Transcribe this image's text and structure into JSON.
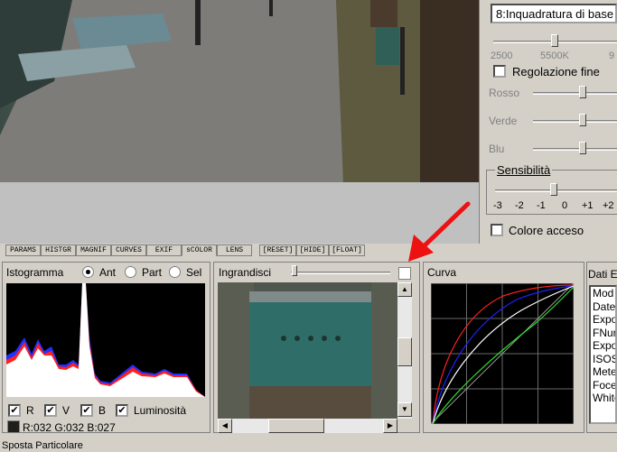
{
  "right_panel": {
    "preset_value": "8:Inquadratura di base",
    "wb_scale": [
      "2500",
      "5500K",
      "9"
    ],
    "regolazione_fine": "Regolazione fine",
    "rosso": "Rosso",
    "verde": "Verde",
    "blu": "Blu",
    "sensibilita_title": "Sensibilità",
    "sens_scale": [
      "-3",
      "-2",
      "-1",
      "0",
      "+1",
      "+2"
    ],
    "colore_acceso": "Colore acceso"
  },
  "tabs": [
    "PARAMS",
    "HISTGR",
    "MAGNIF",
    "CURVES",
    "EXIF",
    "sCOLOR",
    "LENS",
    "[RESET]",
    "[HIDE]",
    "[FLOAT]"
  ],
  "istogramma": {
    "title": "Istogramma",
    "opt_ant": "Ant",
    "opt_part": "Part",
    "opt_sel": "Sel",
    "chk_r": "R",
    "chk_v": "V",
    "chk_b": "B",
    "chk_lum": "Luminosità",
    "rgb_readout": "R:032 G:032 B:027"
  },
  "ingrandisci": {
    "title": "Ingrandisci"
  },
  "curva": {
    "title": "Curva"
  },
  "dati": {
    "title": "Dati E",
    "fields": [
      "Mod",
      "Date",
      "Expo",
      "FNur",
      "Expo",
      "ISOS",
      "Mete",
      "Foce",
      "White"
    ]
  },
  "status": "Sposta Particolare",
  "colors": {
    "annotation_arrow": "#ee1111",
    "curve_red": "#ff2020",
    "curve_blue": "#2020ff",
    "curve_green": "#30e030"
  }
}
